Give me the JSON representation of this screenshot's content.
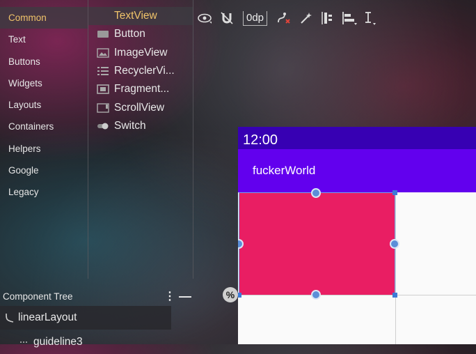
{
  "palette": {
    "categories": [
      "Common",
      "Text",
      "Buttons",
      "Widgets",
      "Layouts",
      "Containers",
      "Helpers",
      "Google",
      "Legacy"
    ],
    "widgets": [
      {
        "label": "TextView",
        "icon": "textview-icon"
      },
      {
        "label": "Button",
        "icon": "button-icon"
      },
      {
        "label": "ImageView",
        "icon": "image-icon"
      },
      {
        "label": "RecyclerVi...",
        "icon": "list-icon"
      },
      {
        "label": "Fragment...",
        "icon": "fragment-icon"
      },
      {
        "label": "ScrollView",
        "icon": "scrollview-icon"
      },
      {
        "label": "Switch",
        "icon": "switch-icon"
      }
    ]
  },
  "toolbar": {
    "margin_value": "0dp",
    "icons": [
      "eye-icon",
      "magnet-off-icon",
      "clear-constraints-icon",
      "infer-constraints-icon",
      "pack-icon",
      "align-icon",
      "guidelines-icon"
    ]
  },
  "device": {
    "time": "12:00",
    "app_title": "fuckerWorld",
    "colors": {
      "status_bar": "#3700b3",
      "app_bar": "#6200ee",
      "view_bg": "#e91e63",
      "canvas": "#fafafa"
    }
  },
  "percent_badge": "%",
  "component_tree": {
    "title": "Component Tree",
    "rows": [
      {
        "label": "linearLayout",
        "icon": "layout-icon"
      },
      {
        "label": "guideline3",
        "icon": "guideline-icon"
      }
    ]
  }
}
